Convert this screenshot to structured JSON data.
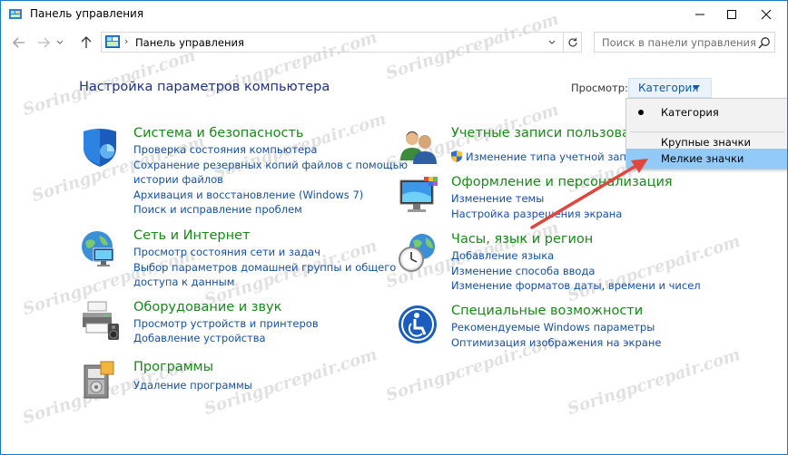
{
  "window": {
    "title": "Панель управления"
  },
  "address": {
    "path": "Панель управления",
    "separator": "›"
  },
  "search": {
    "placeholder": "Поиск в панели управления"
  },
  "main": {
    "heading": "Настройка параметров компьютера",
    "view_label": "Просмотр:",
    "view_value": "Категория"
  },
  "view_menu": {
    "items": [
      {
        "label": "Категория",
        "selected": true
      },
      {
        "label": "Крупные значки"
      },
      {
        "label": "Мелкие значки",
        "highlighted": true
      }
    ]
  },
  "categories_left": [
    {
      "title": "Система и безопасность",
      "icon": "shield-icon",
      "links": [
        "Проверка состояния компьютера",
        "Сохранение резервных копий файлов с помощью",
        "истории файлов",
        "Архивация и восстановление (Windows 7)",
        "Поиск и исправление проблем"
      ]
    },
    {
      "title": "Сеть и Интернет",
      "icon": "network-globe-icon",
      "links": [
        "Просмотр состояния сети и задач",
        "Выбор параметров домашней группы и общего",
        "доступа к данным"
      ]
    },
    {
      "title": "Оборудование и звук",
      "icon": "printer-icon",
      "links": [
        "Просмотр устройств и принтеров",
        "Добавление устройства"
      ]
    },
    {
      "title": "Программы",
      "icon": "programs-icon",
      "links": [
        "Удаление программы"
      ]
    }
  ],
  "categories_right": [
    {
      "title": "Учетные записи пользовате",
      "icon": "users-icon",
      "links": [
        "Изменение типа учетной записи"
      ]
    },
    {
      "title": "Оформление и персонализация",
      "icon": "monitor-color-icon",
      "links": [
        "Изменение темы",
        "Настройка разрешения экрана"
      ]
    },
    {
      "title": "Часы, язык и регион",
      "icon": "clock-globe-icon",
      "links": [
        "Добавление языка",
        "Изменение способа ввода",
        "Изменение форматов даты, времени и чисел"
      ]
    },
    {
      "title": "Специальные возможности",
      "icon": "accessibility-icon",
      "links": [
        "Рекомендуемые Windows параметры",
        "Оптимизация изображения на экране"
      ]
    }
  ],
  "watermark": "Soringpcrepair.com",
  "colors": {
    "heading": "#1e3287",
    "category_title": "#168a16",
    "link": "#1451a6",
    "menu_highlight": "#91c9f7",
    "annotation_arrow": "#e0463c"
  }
}
